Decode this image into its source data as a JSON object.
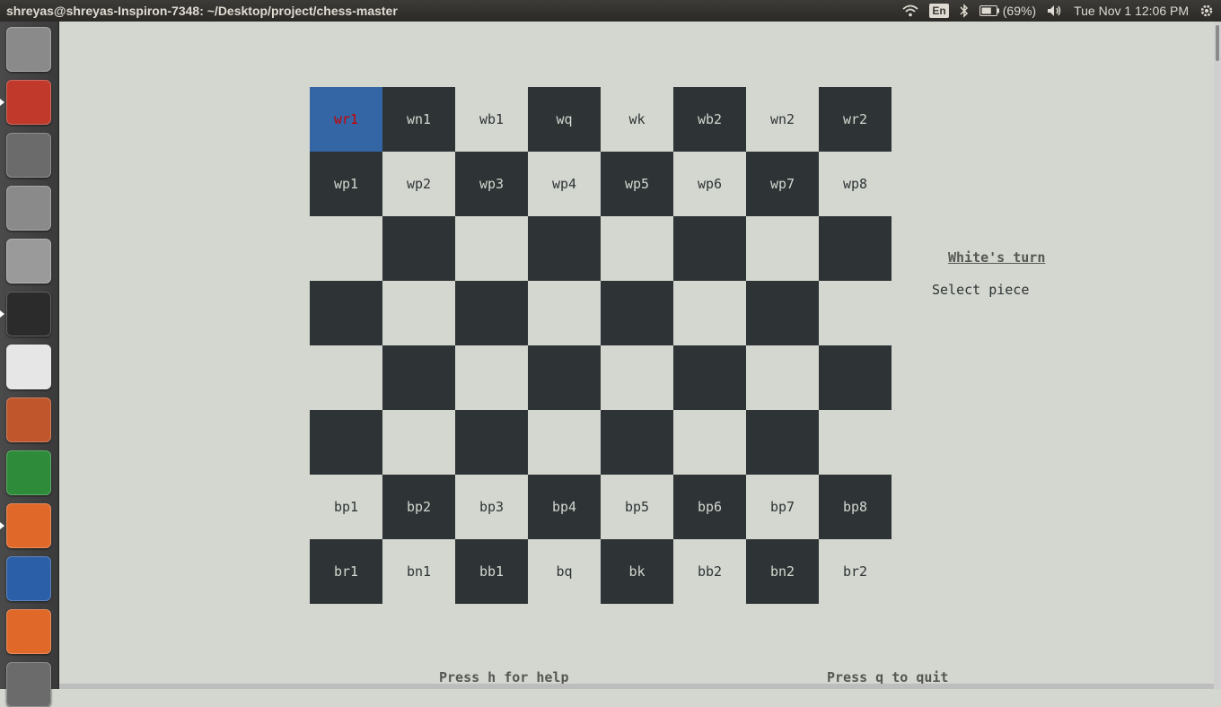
{
  "window": {
    "title": "shreyas@shreyas-Inspiron-7348: ~/Desktop/project/chess-master"
  },
  "indicators": {
    "language": "En",
    "battery": "(69%)",
    "datetime": "Tue Nov  1 12:06 PM"
  },
  "launcher": [
    {
      "name": "ubuntu-dash-icon",
      "color": "#8a8a8a"
    },
    {
      "name": "files-icon",
      "color": "#c0392b"
    },
    {
      "name": "system-settings-icon",
      "color": "#6b6b6b"
    },
    {
      "name": "image-viewer-icon",
      "color": "#8a8a8a"
    },
    {
      "name": "disk-icon",
      "color": "#9a9a9a"
    },
    {
      "name": "terminal-icon",
      "color": "#2b2b2b"
    },
    {
      "name": "amazon-icon",
      "color": "#e6e6e6"
    },
    {
      "name": "impress-icon",
      "color": "#c0562b"
    },
    {
      "name": "calc-icon",
      "color": "#2e8b3a"
    },
    {
      "name": "firefox-icon",
      "color": "#e0692a"
    },
    {
      "name": "writer-icon",
      "color": "#2b5fa8"
    },
    {
      "name": "software-center-icon",
      "color": "#e0692a"
    },
    {
      "name": "workspace-icon",
      "color": "#6b6b6b"
    }
  ],
  "board": {
    "selected": "wr1",
    "rows": [
      [
        "wr1",
        "wn1",
        "wb1",
        "wq",
        "wk",
        "wb2",
        "wn2",
        "wr2"
      ],
      [
        "wp1",
        "wp2",
        "wp3",
        "wp4",
        "wp5",
        "wp6",
        "wp7",
        "wp8"
      ],
      [
        "",
        "",
        "",
        "",
        "",
        "",
        "",
        ""
      ],
      [
        "",
        "",
        "",
        "",
        "",
        "",
        "",
        ""
      ],
      [
        "",
        "",
        "",
        "",
        "",
        "",
        "",
        ""
      ],
      [
        "",
        "",
        "",
        "",
        "",
        "",
        "",
        ""
      ],
      [
        "bp1",
        "bp2",
        "bp3",
        "bp4",
        "bp5",
        "bp6",
        "bp7",
        "bp8"
      ],
      [
        "br1",
        "bn1",
        "bb1",
        "bq",
        "bk",
        "bb2",
        "bn2",
        "br2"
      ]
    ]
  },
  "sidebar": {
    "turn": "White's turn",
    "status": "Select piece"
  },
  "footer": {
    "help": "Press h for help",
    "quit": "Press q to quit"
  }
}
